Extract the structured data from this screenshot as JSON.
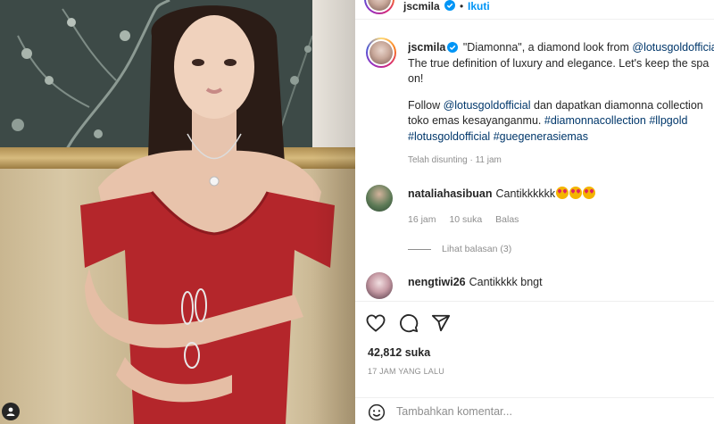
{
  "post": {
    "username": "jscmila",
    "follow_label": "Ikuti",
    "separator": "•"
  },
  "caption": {
    "username": "jscmila",
    "line1_text": " \"Diamonna\", a diamond look from ",
    "line1_mention": "@lotusgoldofficial",
    "line2": "The true definition of luxury and elegance. Let's keep the spa",
    "line3": "on!",
    "line4_text": "Follow ",
    "line4_mention": "@lotusgoldofficial",
    "line4_rest": " dan dapatkan diamonna collection",
    "line5_text": "toko emas kesayanganmu. ",
    "line5_tag1": "#diamonnacollection",
    "line5_tag2": "#llpgold",
    "line6_tag1": "#lotusgoldofficial",
    "line6_tag2": "#guegenerasiemas",
    "edited": "Telah disunting · 11 jam"
  },
  "comments": [
    {
      "username": "nataliahasibuan",
      "text": "Cantikkkkkk",
      "emoji_count": 3,
      "time": "16 jam",
      "likes": "10 suka",
      "reply": "Balas",
      "view_replies": "Lihat balasan (3)"
    },
    {
      "username": "nengtiwi26",
      "text": "Cantikkkk bngt"
    }
  ],
  "actions": {
    "like_icon": "heart-icon",
    "comment_icon": "comment-icon",
    "share_icon": "share-icon",
    "likes_count": "42,812 suka",
    "time_ago": "17 JAM YANG LALU"
  },
  "comment_box": {
    "placeholder": "Tambahkan komentar..."
  },
  "colors": {
    "link": "#00376b",
    "follow": "#0095f6",
    "verified": "#0095f6",
    "muted": "#8e8e8e"
  }
}
